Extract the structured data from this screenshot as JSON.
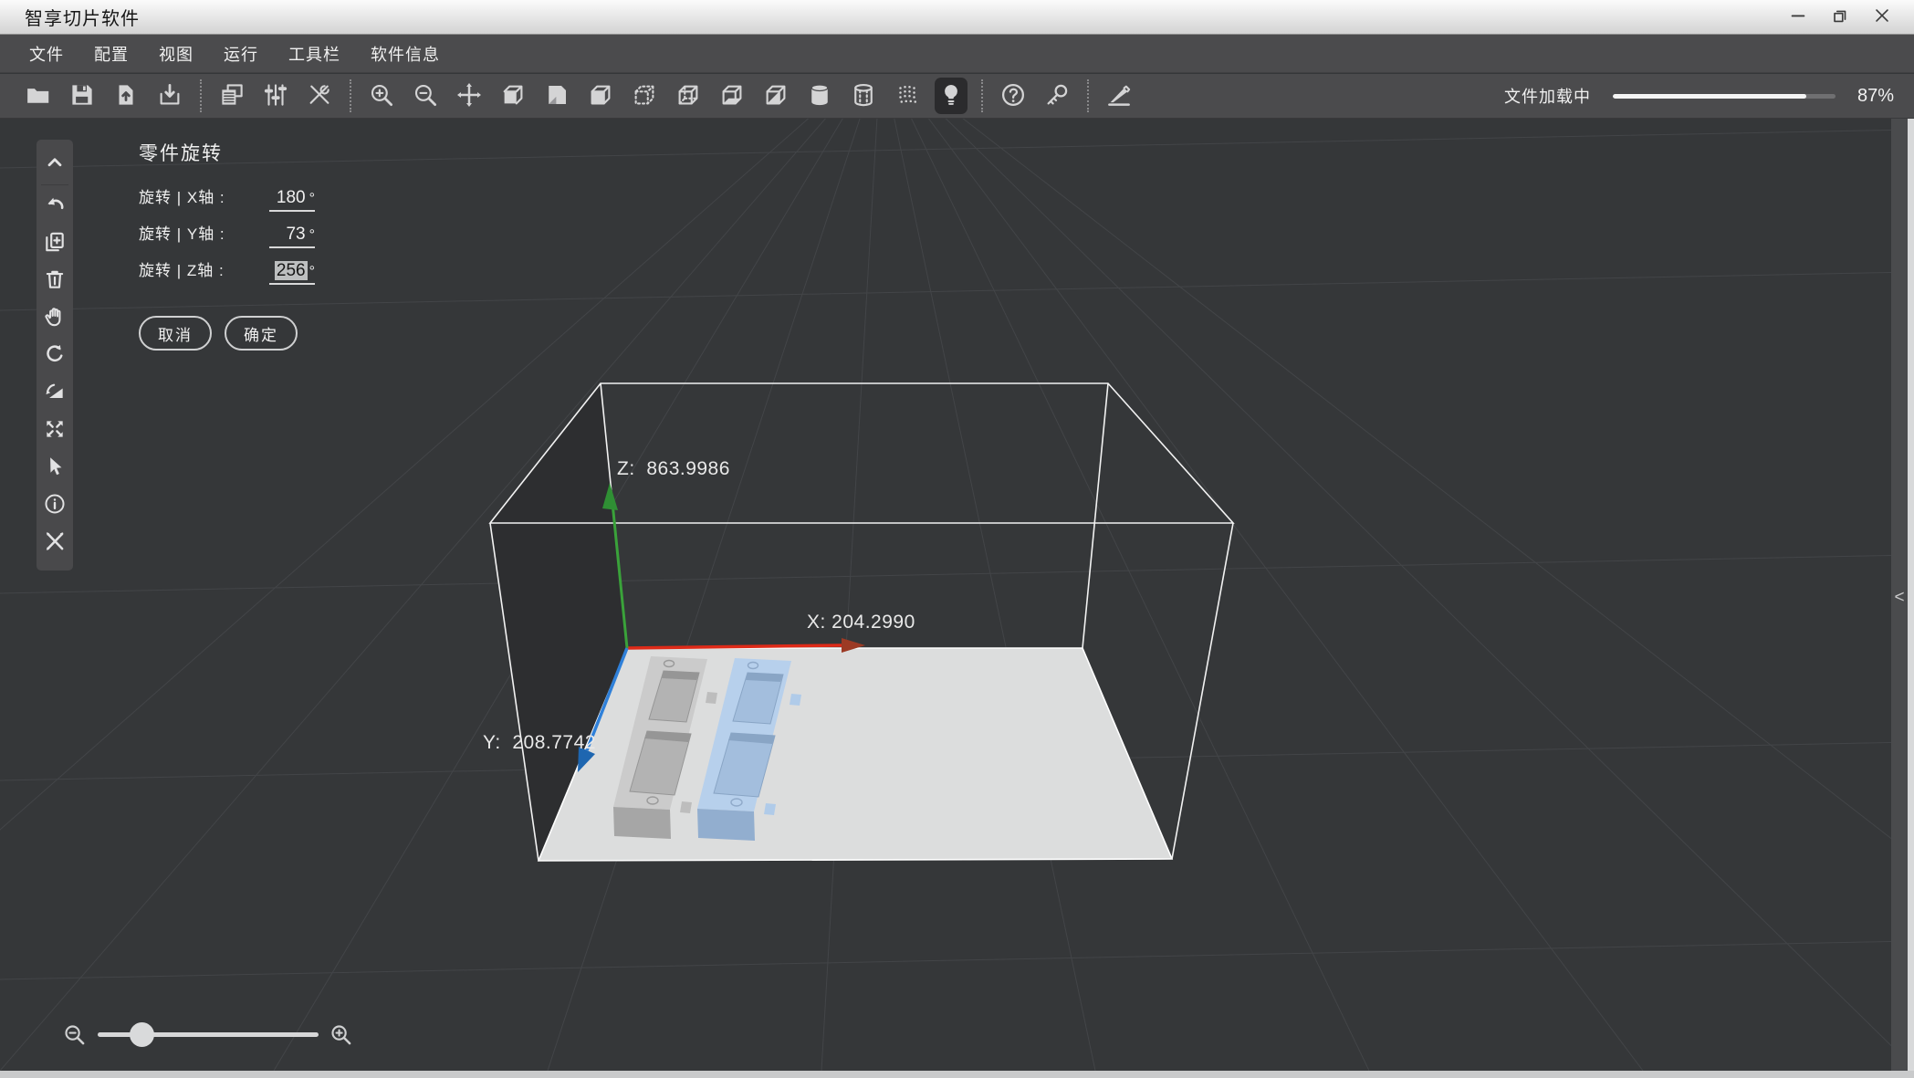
{
  "window": {
    "title": "智享切片软件",
    "controls": [
      {
        "name": "minimize",
        "icon": "win-min"
      },
      {
        "name": "restore",
        "icon": "win-restore"
      },
      {
        "name": "close",
        "icon": "win-close"
      }
    ]
  },
  "menu": {
    "items": [
      "文件",
      "配置",
      "视图",
      "运行",
      "工具栏",
      "软件信息"
    ]
  },
  "toolbar": {
    "groups": [
      [
        "open-file",
        "save-file",
        "import-model",
        "export-model"
      ],
      [
        "copy-plate",
        "adjust-params",
        "tools"
      ],
      [
        "zoom-in",
        "zoom-out",
        "move-model",
        "view-solid",
        "view-flip",
        "view-face",
        "view-dotted",
        "view-hidden",
        "view-bottom",
        "view-section",
        "cylinder-solid",
        "cylinder-wireframe",
        "point-cloud",
        "light"
      ],
      [
        "help",
        "key"
      ],
      [
        "slice-brush"
      ]
    ],
    "active_icon": "light"
  },
  "loading": {
    "label": "文件加载中",
    "percent": 87,
    "percent_label": "87%"
  },
  "side_toolbar": {
    "icons": [
      "collapse-up",
      "undo",
      "duplicate",
      "delete",
      "pan-hand",
      "rotate",
      "mirror-rotate",
      "fit-view",
      "select-cursor",
      "info",
      "repair"
    ]
  },
  "rotation_panel": {
    "title": "零件旋转",
    "rows": [
      {
        "axis": "x",
        "label": "旋转 | X轴 :",
        "value": "180",
        "unit": "°",
        "selected": false
      },
      {
        "axis": "y",
        "label": "旋转 | Y轴 :",
        "value": "73",
        "unit": "°",
        "selected": false
      },
      {
        "axis": "z",
        "label": "旋转 | Z轴 :",
        "value": "256",
        "unit": "°",
        "selected": true
      }
    ],
    "cancel_label": "取消",
    "confirm_label": "确定"
  },
  "viewport": {
    "axis_labels": {
      "z": "Z:  863.9986",
      "x": "X: 204.2990",
      "y": "Y:  208.7742"
    },
    "axis_colors": {
      "x": "#de2a18",
      "y": "#2f80d9",
      "z": "#3aa23a"
    },
    "plate_color": "#dcdddd",
    "collapse_chevron": "<",
    "models": [
      {
        "name": "model-gray",
        "body": "#cbcbcb",
        "front": "#a6a6a6",
        "pocket": "#b3b3b3",
        "wall": "#969696",
        "line": "#9a9a9a",
        "tab": "#bdbdbd"
      },
      {
        "name": "model-blue",
        "body": "#b7d0ec",
        "front": "#92aecf",
        "pocket": "#a3bedd",
        "wall": "#89a5c5",
        "line": "#8fa9c9",
        "tab": "#b0cbe9"
      }
    ]
  },
  "zoom_slider": {
    "value_percent": 20
  }
}
